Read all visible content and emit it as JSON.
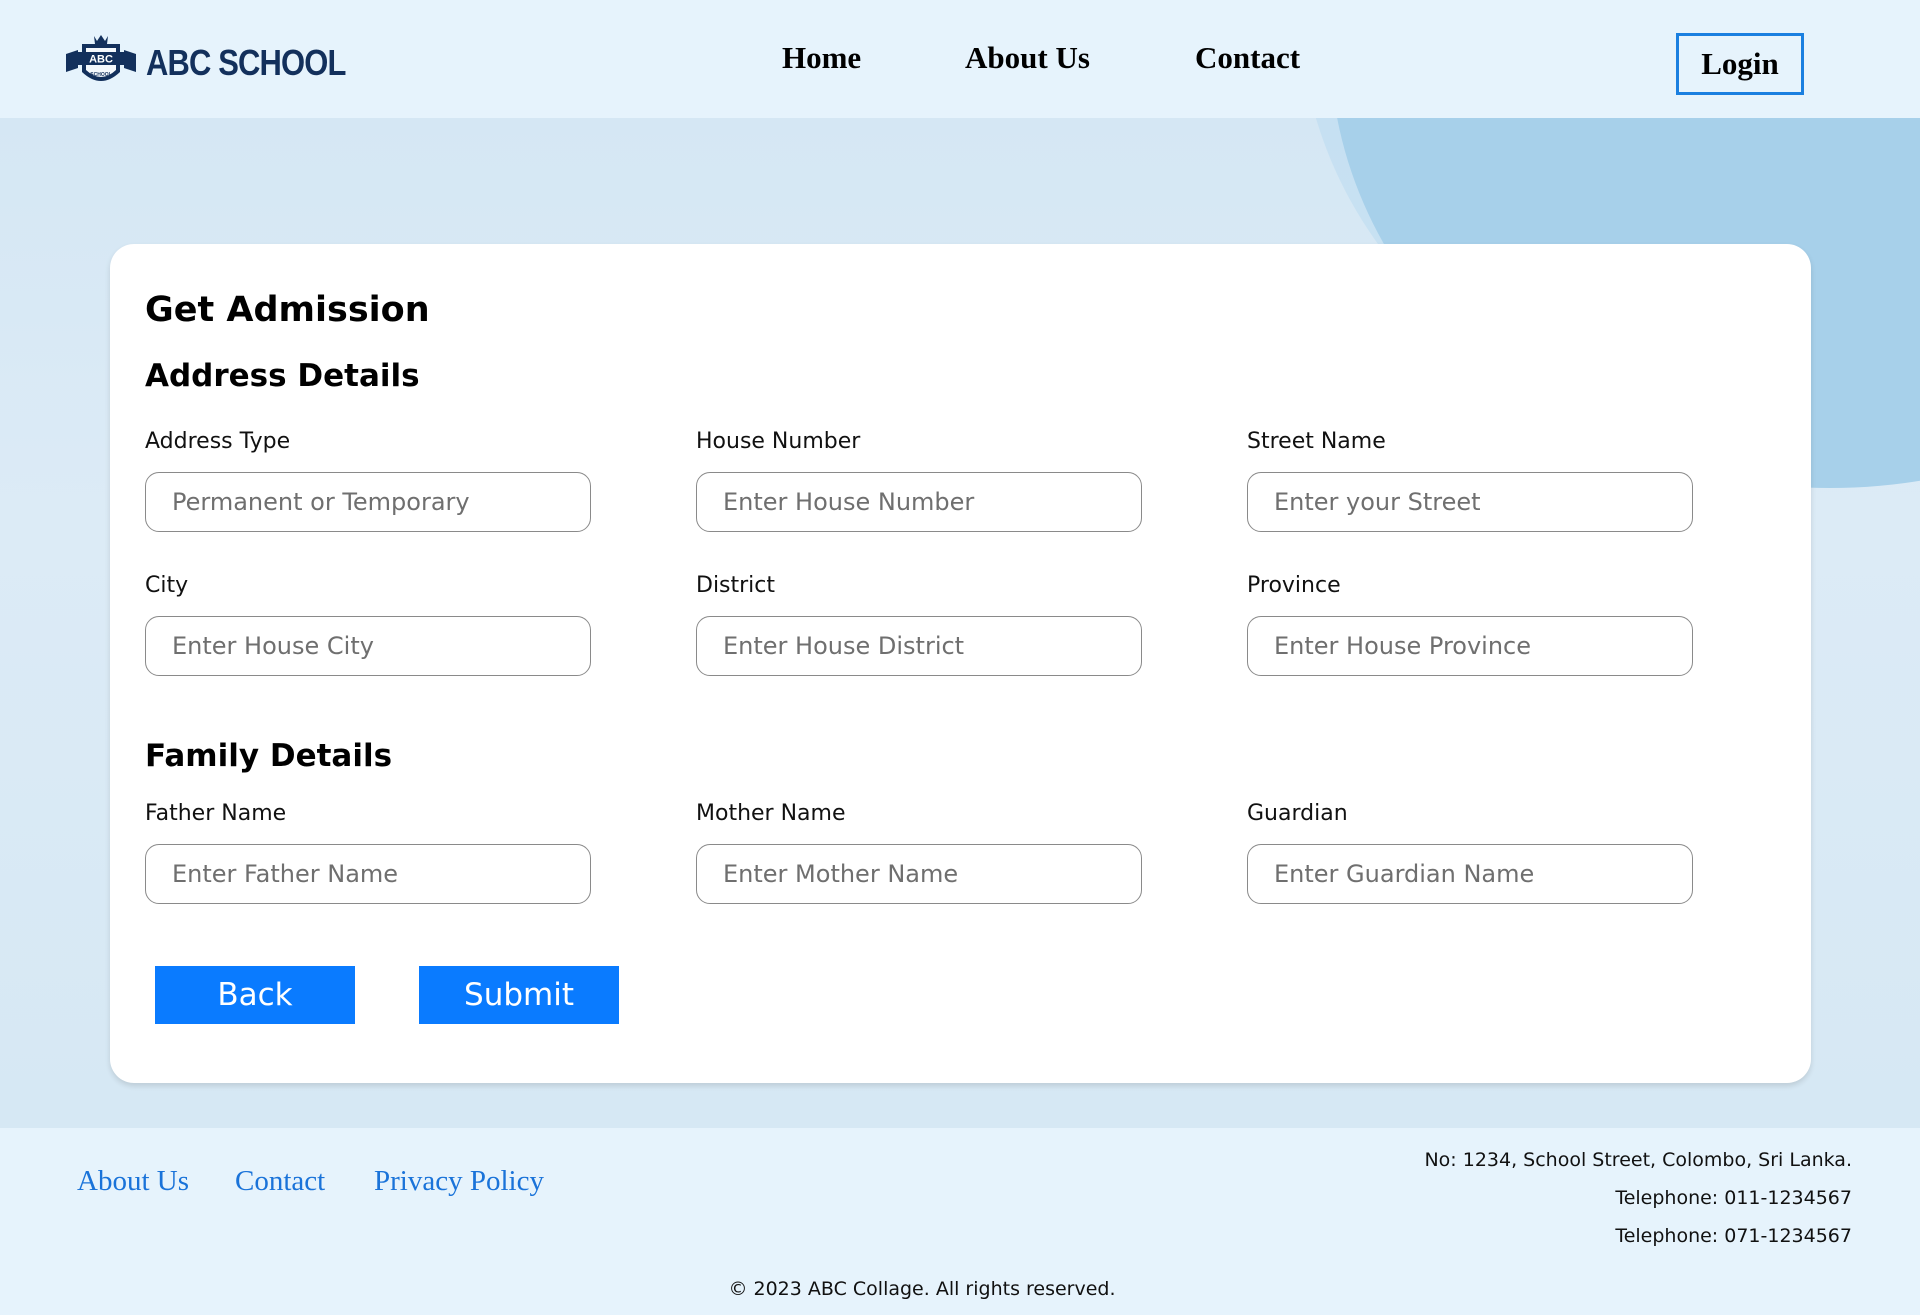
{
  "header": {
    "brand": "ABC SCHOOL",
    "logo_badge_text": "ABC",
    "logo_badge_sub": "SCHOOL",
    "nav": [
      "Home",
      "About Us",
      "Contact"
    ],
    "login_label": "Login"
  },
  "form": {
    "title": "Get Admission",
    "address_section": "Address Details",
    "family_section": "Family Details",
    "fields": {
      "address_type": {
        "label": "Address Type",
        "placeholder": "Permanent or Temporary"
      },
      "house_number": {
        "label": "House Number",
        "placeholder": "Enter House Number"
      },
      "street_name": {
        "label": "Street Name",
        "placeholder": "Enter your Street"
      },
      "city": {
        "label": "City",
        "placeholder": "Enter House City"
      },
      "district": {
        "label": "District",
        "placeholder": "Enter House District"
      },
      "province": {
        "label": "Province",
        "placeholder": "Enter House Province"
      },
      "father_name": {
        "label": "Father Name",
        "placeholder": "Enter Father Name"
      },
      "mother_name": {
        "label": "Mother Name",
        "placeholder": "Enter Mother Name"
      },
      "guardian": {
        "label": "Guardian",
        "placeholder": "Enter Guardian Name"
      }
    },
    "back_label": "Back",
    "submit_label": "Submit"
  },
  "footer": {
    "links": [
      "About Us",
      "Contact",
      "Privacy Policy"
    ],
    "address": "No: 1234, School Street, Colombo, Sri Lanka.",
    "phone1": "Telephone: 011-1234567",
    "phone2": "Telephone: 071-1234567",
    "copyright": "© 2023 ABC Collage. All rights reserved."
  },
  "colors": {
    "accent": "#0a7bff",
    "link": "#1a73d9",
    "brand": "#13305c",
    "header_bg": "#e6f3fc"
  }
}
